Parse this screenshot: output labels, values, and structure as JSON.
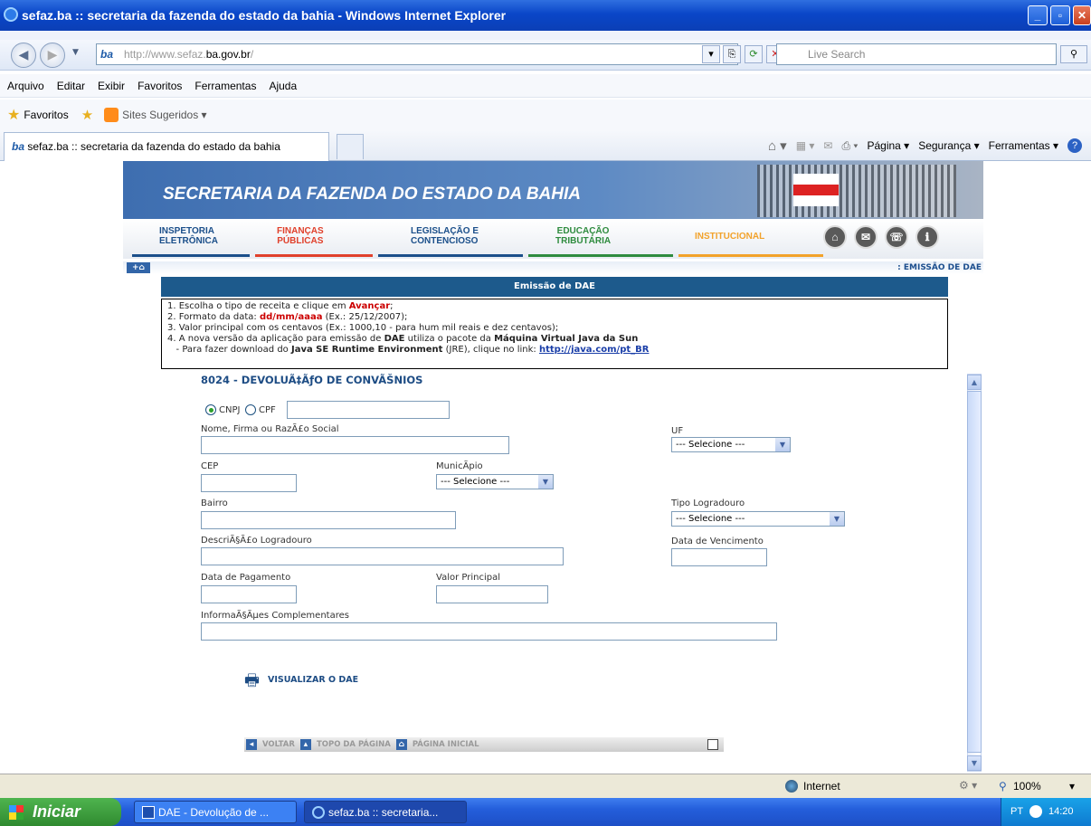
{
  "window": {
    "title": "sefaz.ba :: secretaria da fazenda do estado da bahia - Windows Internet Explorer"
  },
  "address": {
    "logo": "ba",
    "url_prefix": "http://www.sefaz.",
    "url_host": "ba.gov.br",
    "url_suffix": "/",
    "search_placeholder": "Live Search"
  },
  "menu": [
    "Arquivo",
    "Editar",
    "Exibir",
    "Favoritos",
    "Ferramentas",
    "Ajuda"
  ],
  "favorites": {
    "favoritos": "Favoritos",
    "suggested": "Sites Sugeridos ▾"
  },
  "tab": {
    "label": "sefaz.ba :: secretaria da fazenda do estado da bahia"
  },
  "commands": {
    "page": "Página ▾",
    "security": "Segurança ▾",
    "tools": "Ferramentas ▾"
  },
  "site": {
    "banner": "SECRETARIA DA FAZENDA DO ESTADO DA BAHIA",
    "nav": [
      {
        "line1": "INSPETORIA",
        "line2": "ELETRÔNICA",
        "color": "#1b4f8a"
      },
      {
        "line1": "FINANÇAS",
        "line2": "PÚBLICAS",
        "color": "#e0402b"
      },
      {
        "line1": "LEGISLAÇÃO E",
        "line2": "CONTENCIOSO",
        "color": "#1b4f8a"
      },
      {
        "line1": "EDUCAÇÃO",
        "line2": "TRIBUTÁRIA",
        "color": "#2e8b3e"
      },
      {
        "line1": "INSTITUCIONAL",
        "line2": "",
        "color": "#f2a22a"
      }
    ],
    "breadcrumb": ": EMISSÃO DE DAE",
    "section_title": "Emissão de DAE"
  },
  "instructions": {
    "l1a": "1. Escolha o tipo de receita e clique em ",
    "l1b": "Avançar",
    "l1c": ";",
    "l2a": "2. Formato da data: ",
    "l2b": "dd/mm/aaaa",
    "l2c": " (Ex.: 25/12/2007);",
    "l3": "3. Valor principal com os centavos (Ex.: 1000,10 - para hum mil reais e dez centavos);",
    "l4a": "4. A nova versão da aplicação para emissão de ",
    "l4b": "DAE",
    "l4c": " utiliza o pacote da ",
    "l4d": "Máquina Virtual Java da Sun",
    "l5a": "   - Para fazer download do ",
    "l5b": "Java SE Runtime Environment",
    "l5c": " (JRE), clique no link: ",
    "l5d": "http://java.com/pt_BR"
  },
  "form": {
    "title": "8024 - DEVOLUÃ‡ÃƒO DE CONVÃŠNIOS",
    "cnpj": "CNPJ",
    "cpf": "CPF",
    "nome": "Nome, Firma ou RazÃ£o Social",
    "uf": "UF",
    "cep": "CEP",
    "municipio": "MunicÃ­pio",
    "bairro": "Bairro",
    "tipo_logradouro": "Tipo Logradouro",
    "descricao": "DescriÃ§Ã£o Logradouro",
    "vencimento": "Data de Vencimento",
    "pagamento": "Data de Pagamento",
    "valor": "Valor Principal",
    "info": "InformaÃ§Ãµes Complementares",
    "select_default": "--- Selecione ---",
    "visualizar": "VISUALIZAR O DAE"
  },
  "footer_nav": {
    "voltar": "VOLTAR",
    "topo": "TOPO DA PÁGINA",
    "inicial": "PÁGINA INICIAL"
  },
  "status": {
    "zone": "Internet",
    "zoom": "100%"
  },
  "taskbar": {
    "start": "Iniciar",
    "task1": "DAE - Devolução de ...",
    "task2": "sefaz.ba :: secretaria...",
    "lang": "PT",
    "time": "14:20"
  }
}
